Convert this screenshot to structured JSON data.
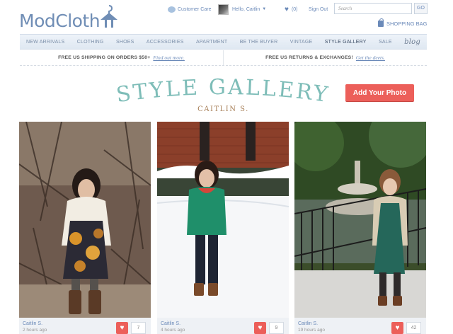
{
  "brand": {
    "name": "ModCloth"
  },
  "header": {
    "customer_care": "Customer Care",
    "greeting": "Hello, Caitlin",
    "favorites_count": "(0)",
    "sign_out": "Sign Out",
    "search_placeholder": "Search",
    "go_label": "GO",
    "bag_label": "SHOPPING BAG"
  },
  "nav": {
    "items": [
      "NEW ARRIVALS",
      "CLOTHING",
      "SHOES",
      "ACCESSORIES",
      "APARTMENT",
      "BE THE BUYER",
      "VINTAGE",
      "STYLE GALLERY",
      "SALE"
    ],
    "active": "STYLE GALLERY",
    "blog": "blog"
  },
  "promos": [
    {
      "text": "FREE US SHIPPING ON ORDERS $50+",
      "link": "Find out more."
    },
    {
      "text": "FREE US RETURNS & EXCHANGES!",
      "link": "Get the deets."
    }
  ],
  "page": {
    "title": "STYLE GALLERY",
    "subtitle": "CAITLIN S.",
    "add_button": "Add Your Photo"
  },
  "cards": [
    {
      "name": "Caitlin S.",
      "time": "2 hours ago",
      "count": "7"
    },
    {
      "name": "Caitlin S.",
      "time": "4 hours ago",
      "count": "9"
    },
    {
      "name": "Caitlin S.",
      "time": "19 hours ago",
      "count": "42"
    }
  ],
  "colors": {
    "brand_blue": "#6f8db5",
    "title_teal": "#7ebdb8",
    "accent_red": "#ec5f5a",
    "subtitle_brown": "#a77f58"
  },
  "icons": [
    "chat-bubble-icon",
    "heart-icon",
    "shopping-bag-icon",
    "hanger-icon",
    "caret-down-icon"
  ]
}
